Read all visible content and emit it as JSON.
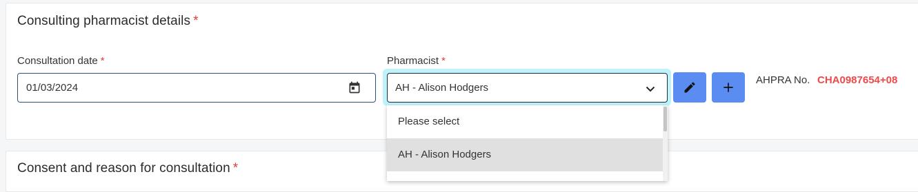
{
  "section": {
    "title": "Consulting pharmacist details",
    "required_mark": "*",
    "next_title": "Consent and reason for consultation"
  },
  "consultation_date": {
    "label": "Consultation date",
    "value": "01/03/2024"
  },
  "pharmacist": {
    "label": "Pharmacist",
    "selected": "AH - Alison Hodgers",
    "options": [
      "Please select",
      "AH - Alison Hodgers"
    ]
  },
  "ahpra": {
    "label": "AHPRA No.",
    "value": "CHA0987654+08"
  },
  "colors": {
    "accent": "#5a8cf2",
    "required": "#e53935",
    "ahpra_value": "#f04848",
    "focus_ring": "#bff3fb"
  }
}
